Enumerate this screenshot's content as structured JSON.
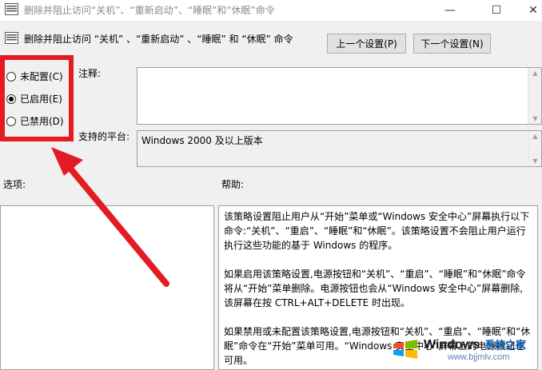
{
  "window": {
    "title": "删除并阻止访问“关机”、“重新启动”、“睡眠”和“休眠”命令",
    "minimize": "—",
    "maximize": "☐",
    "close": "✕"
  },
  "header": {
    "policy_name": "删除并阻止访问 “关机” 、“重新启动” 、“睡眠” 和 “休眠” 命令",
    "prev_label": "上一个设置(P)",
    "next_label": "下一个设置(N)"
  },
  "state": {
    "options": [
      {
        "label": "未配置(C)",
        "checked": false
      },
      {
        "label": "已启用(E)",
        "checked": true
      },
      {
        "label": "已禁用(D)",
        "checked": false
      }
    ]
  },
  "fields": {
    "comment_label": "注释:",
    "comment_value": "",
    "platform_label": "支持的平台:",
    "platform_value": "Windows 2000 及以上版本"
  },
  "sections": {
    "options_label": "选项:",
    "help_label": "帮助:"
  },
  "help": {
    "p1": "该策略设置阻止用户从“开始”菜单或“Windows 安全中心”屏幕执行以下命令:“关机”、“重启”、“睡眠”和“休眠”。该策略设置不会阻止用户运行执行这些功能的基于 Windows 的程序。",
    "p2": "如果启用该策略设置,电源按钮和“关机”、“重启”、“睡眠”和“休眠”命令将从“开始”菜单删除。电源按钮也会从“Windows 安全中心”屏幕删除,该屏幕在按 CTRL+ALT+DELETE 时出现。",
    "p3": "如果禁用或未配置该策略设置,电源按钮和“关机”、“重启”、“睡眠”和“休眠”命令在“开始”菜单可用。“Windows 安全中心”屏幕上的电源按钮也可用。"
  },
  "watermark": {
    "brand": "Windows",
    "cn": "系统之家",
    "url": "www.bjjmlv.com"
  },
  "colors": {
    "highlight": "#e31b23",
    "background": "#f0f0f0"
  }
}
